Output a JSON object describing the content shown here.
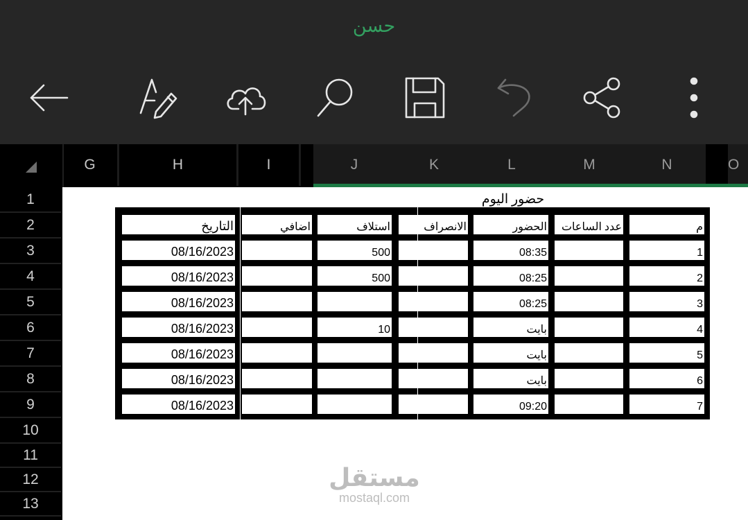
{
  "app": {
    "document_title": "حسن"
  },
  "toolbar": {
    "buttons": [
      {
        "id": "back",
        "icon": "back-arrow-icon"
      },
      {
        "id": "draw",
        "icon": "draw-pen-icon"
      },
      {
        "id": "upload",
        "icon": "cloud-upload-icon"
      },
      {
        "id": "search",
        "icon": "search-icon"
      },
      {
        "id": "save",
        "icon": "save-icon"
      },
      {
        "id": "undo",
        "icon": "undo-icon",
        "disabled": true
      },
      {
        "id": "share",
        "icon": "share-icon"
      },
      {
        "id": "more",
        "icon": "more-vertical-icon"
      }
    ]
  },
  "columns": [
    "G",
    "H",
    "I",
    "J",
    "K",
    "L",
    "M",
    "N",
    "O"
  ],
  "rows": [
    "1",
    "2",
    "3",
    "4",
    "5",
    "6",
    "7",
    "8",
    "9",
    "10",
    "11",
    "12",
    "13"
  ],
  "sheet": {
    "title": "حضور اليوم",
    "headers": {
      "date": "التاريخ",
      "extra": "اضافي",
      "advance": "استلاف",
      "leave": "الانصراف",
      "attendance": "الحضور",
      "hours": "عدد الساعات",
      "index": "م"
    },
    "records": [
      {
        "date": "08/16/2023",
        "extra": "",
        "advance": "500",
        "leave": "",
        "attendance": "08:35",
        "hours": "",
        "index": "1"
      },
      {
        "date": "08/16/2023",
        "extra": "",
        "advance": "500",
        "leave": "",
        "attendance": "08:25",
        "hours": "",
        "index": "2"
      },
      {
        "date": "08/16/2023",
        "extra": "",
        "advance": "",
        "leave": "",
        "attendance": "08:25",
        "hours": "",
        "index": "3"
      },
      {
        "date": "08/16/2023",
        "extra": "",
        "advance": "10",
        "leave": "",
        "attendance": "بايت",
        "hours": "",
        "index": "4"
      },
      {
        "date": "08/16/2023",
        "extra": "",
        "advance": "",
        "leave": "",
        "attendance": "بايت",
        "hours": "",
        "index": "5"
      },
      {
        "date": "08/16/2023",
        "extra": "",
        "advance": "",
        "leave": "",
        "attendance": "بايت",
        "hours": "",
        "index": "6"
      },
      {
        "date": "08/16/2023",
        "extra": "",
        "advance": "",
        "leave": "",
        "attendance": "09:20",
        "hours": "",
        "index": "7"
      }
    ]
  },
  "watermark": {
    "arabic": "مستقل",
    "latin": "mostaql.com"
  },
  "colors": {
    "title_green": "#33a060",
    "selection_green": "#1d7a45",
    "toolbar_bg": "#262626"
  }
}
